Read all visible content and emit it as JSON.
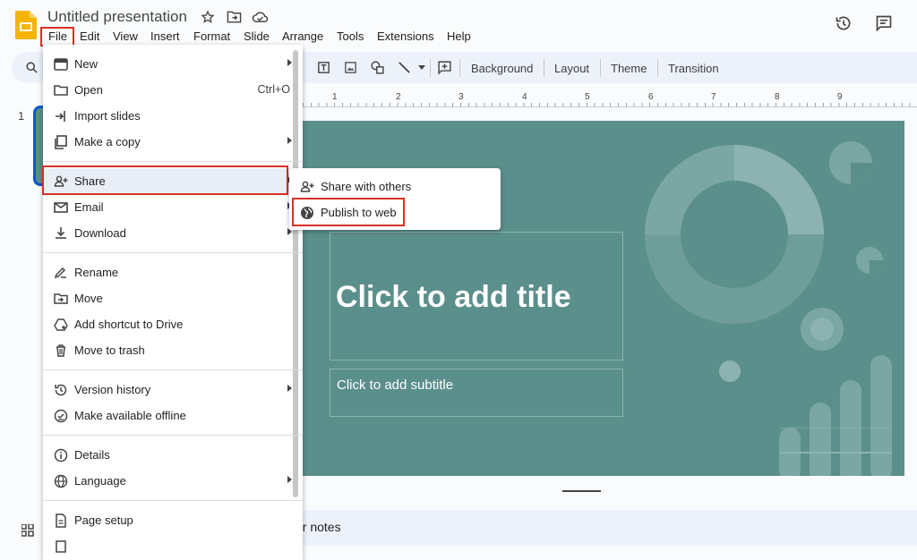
{
  "app": {
    "title": "Untitled presentation",
    "logo_color": "#f4b400"
  },
  "menubar": {
    "items": [
      "File",
      "Edit",
      "View",
      "Insert",
      "Format",
      "Slide",
      "Arrange",
      "Tools",
      "Extensions",
      "Help"
    ]
  },
  "toolbar": {
    "buttons": [
      "Background",
      "Layout",
      "Theme",
      "Transition"
    ]
  },
  "ruler": {
    "labels": [
      "1",
      "2",
      "3",
      "4",
      "5",
      "6",
      "7",
      "8",
      "9"
    ]
  },
  "filmstrip": {
    "slide_number": "1"
  },
  "slide": {
    "background": "#5b8f8b",
    "title_placeholder": "Click to add title",
    "subtitle_placeholder": "Click to add subtitle"
  },
  "notes": {
    "label_partial": "er notes"
  },
  "file_menu": {
    "items": [
      {
        "label": "New",
        "icon": "new-presentation-icon",
        "submenu": true
      },
      {
        "label": "Open",
        "icon": "folder-icon",
        "shortcut": "Ctrl+O"
      },
      {
        "label": "Import slides",
        "icon": "import-icon"
      },
      {
        "label": "Make a copy",
        "icon": "copy-icon",
        "submenu": true
      },
      {
        "label": "Share",
        "icon": "person-add-icon",
        "submenu": true,
        "highlighted": true
      },
      {
        "label": "Email",
        "icon": "mail-icon",
        "submenu": true
      },
      {
        "label": "Download",
        "icon": "download-icon",
        "submenu": true
      },
      {
        "label": "Rename",
        "icon": "rename-icon"
      },
      {
        "label": "Move",
        "icon": "move-folder-icon"
      },
      {
        "label": "Add shortcut to Drive",
        "icon": "drive-shortcut-icon"
      },
      {
        "label": "Move to trash",
        "icon": "trash-icon"
      },
      {
        "label": "Version history",
        "icon": "history-icon",
        "submenu": true
      },
      {
        "label": "Make available offline",
        "icon": "offline-icon"
      },
      {
        "label": "Details",
        "icon": "info-icon"
      },
      {
        "label": "Language",
        "icon": "globe-icon",
        "submenu": true
      },
      {
        "label": "Page setup",
        "icon": "page-setup-icon"
      }
    ]
  },
  "share_submenu": {
    "items": [
      {
        "label": "Share with others",
        "icon": "person-add-icon"
      },
      {
        "label": "Publish to web",
        "icon": "globe-icon",
        "highlighted": true
      }
    ]
  },
  "colors": {
    "highlight_outline": "#d93025",
    "menu_hover": "#e9eef6"
  }
}
